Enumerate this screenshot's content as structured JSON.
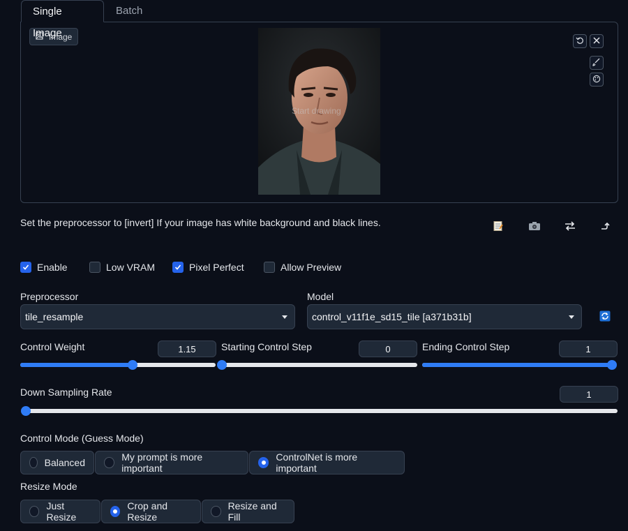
{
  "tabs": [
    {
      "label": "Single Image",
      "active": true
    },
    {
      "label": "Batch",
      "active": false
    }
  ],
  "image_panel": {
    "label": "Image",
    "overlay_text": "Start drawing"
  },
  "hint": "Set the preprocessor to [invert] If your image has white background and black lines.",
  "checkboxes": [
    {
      "label": "Enable",
      "checked": true
    },
    {
      "label": "Low VRAM",
      "checked": false
    },
    {
      "label": "Pixel Perfect",
      "checked": true
    },
    {
      "label": "Allow Preview",
      "checked": false
    }
  ],
  "preprocessor": {
    "label": "Preprocessor",
    "value": "tile_resample"
  },
  "model": {
    "label": "Model",
    "value": "control_v11f1e_sd15_tile [a371b31b]"
  },
  "sliders": {
    "control_weight": {
      "label": "Control Weight",
      "value": "1.15",
      "fraction": 0.575
    },
    "starting_step": {
      "label": "Starting Control Step",
      "value": "0",
      "fraction": 0
    },
    "ending_step": {
      "label": "Ending Control Step",
      "value": "1",
      "fraction": 1
    },
    "down_sampling": {
      "label": "Down Sampling Rate",
      "value": "1",
      "fraction": 0
    }
  },
  "control_mode": {
    "label": "Control Mode (Guess Mode)",
    "options": [
      "Balanced",
      "My prompt is more important",
      "ControlNet is more important"
    ],
    "selected": 2
  },
  "resize_mode": {
    "label": "Resize Mode",
    "options": [
      "Just Resize",
      "Crop and Resize",
      "Resize and Fill"
    ],
    "selected": 1
  },
  "colors": {
    "accent": "#2f7cf6",
    "background": "#0b0f19",
    "surface": "#1f2937"
  }
}
